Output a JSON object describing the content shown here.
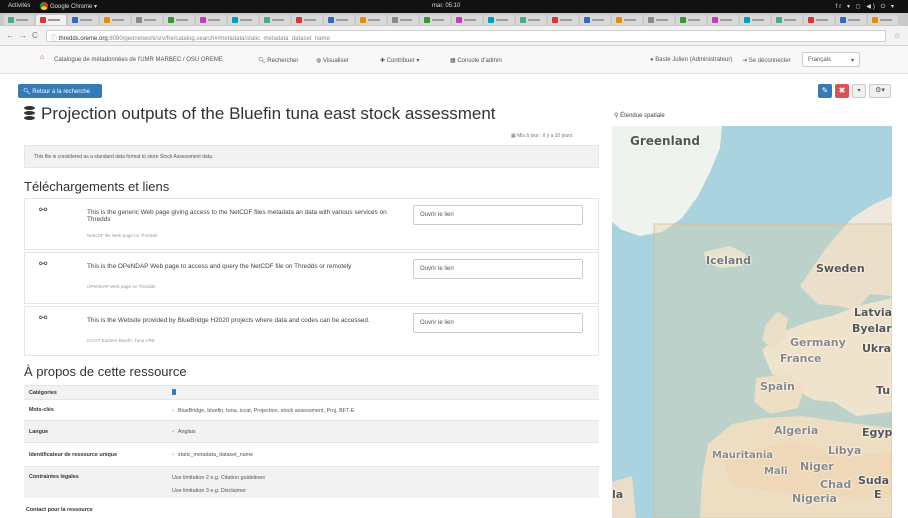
{
  "os": {
    "activities": "Activités",
    "app_name": "Google Chrome ▾",
    "clock": "mar. 05:10",
    "tray": "fr ▾   ◻  ◀)  ⏻ ▾"
  },
  "browser": {
    "url_host": "thredds.oreme.org",
    "url_path": ":8080/geonetwork/srv/fre/catalog.search#/metadata/static_metadata_dataset_name"
  },
  "site": {
    "catalog_title": "Catalogue de métadonnées de l'UMR MARBEC / OSU OREME",
    "nav_search": "Rechercher",
    "nav_view": "Visualiser",
    "nav_contribute": "Contribuer",
    "nav_console": "Console d'admin",
    "user": "Baste Julien (Administrateur)",
    "logout": "Se déconnecter",
    "language": "Français"
  },
  "actions": {
    "back": "Retour à la recherche"
  },
  "record": {
    "title": "Projection outputs of the Bluefin tuna east stock assessment",
    "updated": "Mis à jour : il y a 10 jours",
    "abstract": "This file is considered as a standard data format to store Stock Assessment data."
  },
  "downloads": {
    "heading": "Téléchargements et liens",
    "items": [
      {
        "description": "This is the generic Web page giving access to the NetCDF files metadata an data with various services on Thredds",
        "name": "NetCDF file Web page on Thredds",
        "button": "Ouvrir le lien"
      },
      {
        "description": "This is the OPeNDAP Web page to access and query the NetCDF file on Thredds or remotely",
        "name": "OPeNDAP Web page on Thredds",
        "button": "Ouvrir le lien"
      },
      {
        "description": "This is the Website provided by BlueBridge H2020 projects where data and codes can be accessed.",
        "name": "ICCAT Eastern Bluefin Tuna VRE",
        "button": "Ouvrir le lien"
      }
    ]
  },
  "about": {
    "heading": "À propos de cette ressource",
    "rows": {
      "categories": {
        "label": "Catégories"
      },
      "keywords": {
        "label": "Mots-clés",
        "value": "BlueBridge, bluefin, tuna, iccat, Projection, stock assessment, Proj, BFT-E"
      },
      "language": {
        "label": "Langue",
        "value": "Anglais"
      },
      "identifier": {
        "label": "Identificateur de ressource unique",
        "value": "static_metadata_dataset_name"
      },
      "legal": {
        "label": "Contraintes légales",
        "value1": "Use limitation 2 e.g. Citation guidelines",
        "value2": "Use limitation 3 e.g. Disclaimer"
      }
    },
    "contact_heading": "Contact pour la ressource"
  },
  "map": {
    "label": "Étendue spatiale",
    "places": {
      "greenland": "Greenland",
      "iceland": "Iceland",
      "sweden": "Sweden",
      "latvia": "Latvia",
      "belarus": "Byelar",
      "ukraine": "Ukra",
      "germany": "Germany",
      "france": "France",
      "spain": "Spain",
      "turkey": "Tu",
      "algeria": "Algeria",
      "libya": "Libya",
      "egypt": "Egyp",
      "mauritania": "Mauritania",
      "mali": "Mali",
      "niger": "Niger",
      "chad": "Chad",
      "sudan": "Suda",
      "ethiopia": "E",
      "nigeria": "Nigeria",
      "edge": "la"
    }
  }
}
